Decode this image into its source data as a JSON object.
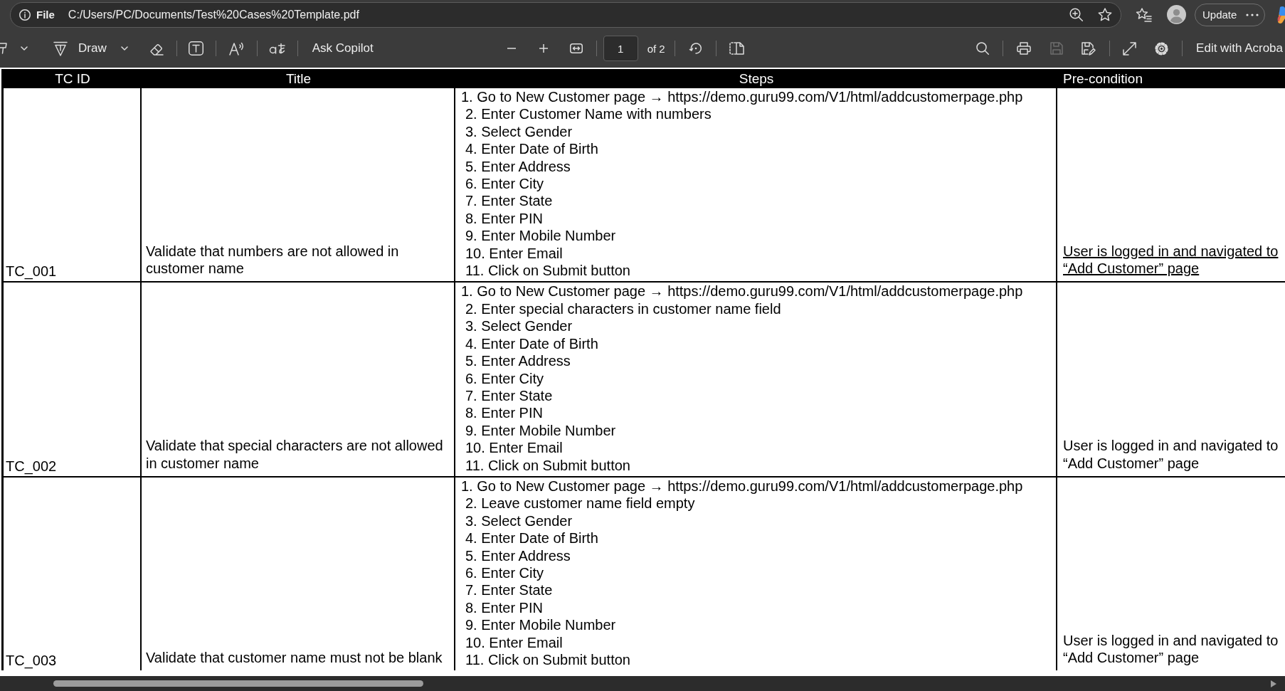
{
  "address_bar": {
    "scheme": "File",
    "url": "C:/Users/PC/Documents/Test%20Cases%20Template.pdf"
  },
  "profile": {
    "update_label": "Update"
  },
  "toolbar": {
    "draw_label": "Draw",
    "copilot_label": "Ask Copilot",
    "page_number": "1",
    "page_count": "of 2",
    "save_disabled": true,
    "edit_label": "Edit with Acroba"
  },
  "table": {
    "columns": [
      "TC ID",
      "Title",
      "Steps",
      "Pre-condition"
    ],
    "rows": [
      {
        "id": "TC_001",
        "title": "Validate that numbers are not allowed in customer name",
        "steps": [
          "1. Go to New Customer page → https://demo.guru99.com/V1/html/addcustomerpage.php",
          "2. Enter Customer Name with numbers",
          "3. Select Gender",
          "4. Enter Date of Birth",
          "5. Enter Address",
          "6. Enter City",
          "7. Enter State",
          "8. Enter PIN",
          "9. Enter Mobile Number",
          "10. Enter Email",
          "11. Click on Submit button"
        ],
        "precondition": "User is logged in and navigated to “Add Customer” page",
        "underlined": true
      },
      {
        "id": "TC_002",
        "title": "Validate that special characters are not allowed in customer name",
        "steps": [
          "1. Go to New Customer page → https://demo.guru99.com/V1/html/addcustomerpage.php",
          "2. Enter special characters in customer name field",
          "3. Select Gender",
          "4. Enter Date of Birth",
          "5. Enter Address",
          "6. Enter City",
          "7. Enter State",
          "8. Enter PIN",
          "9. Enter Mobile Number",
          "10. Enter Email",
          "11. Click on Submit button"
        ],
        "precondition": "User is logged in and navigated to “Add Customer” page",
        "underlined": false
      },
      {
        "id": "TC_003",
        "title": "Validate that customer name must not be blank",
        "steps": [
          "1. Go to New Customer page → https://demo.guru99.com/V1/html/addcustomerpage.php",
          "2. Leave customer name field empty",
          "3. Select Gender",
          "4. Enter Date of Birth",
          "5. Enter Address",
          "6. Enter City",
          "7. Enter State",
          "8. Enter PIN",
          "9. Enter Mobile Number",
          "10. Enter Email",
          "11. Click on Submit button"
        ],
        "precondition": "User is logged in and navigated to “Add Customer” page",
        "underlined": false
      }
    ]
  }
}
